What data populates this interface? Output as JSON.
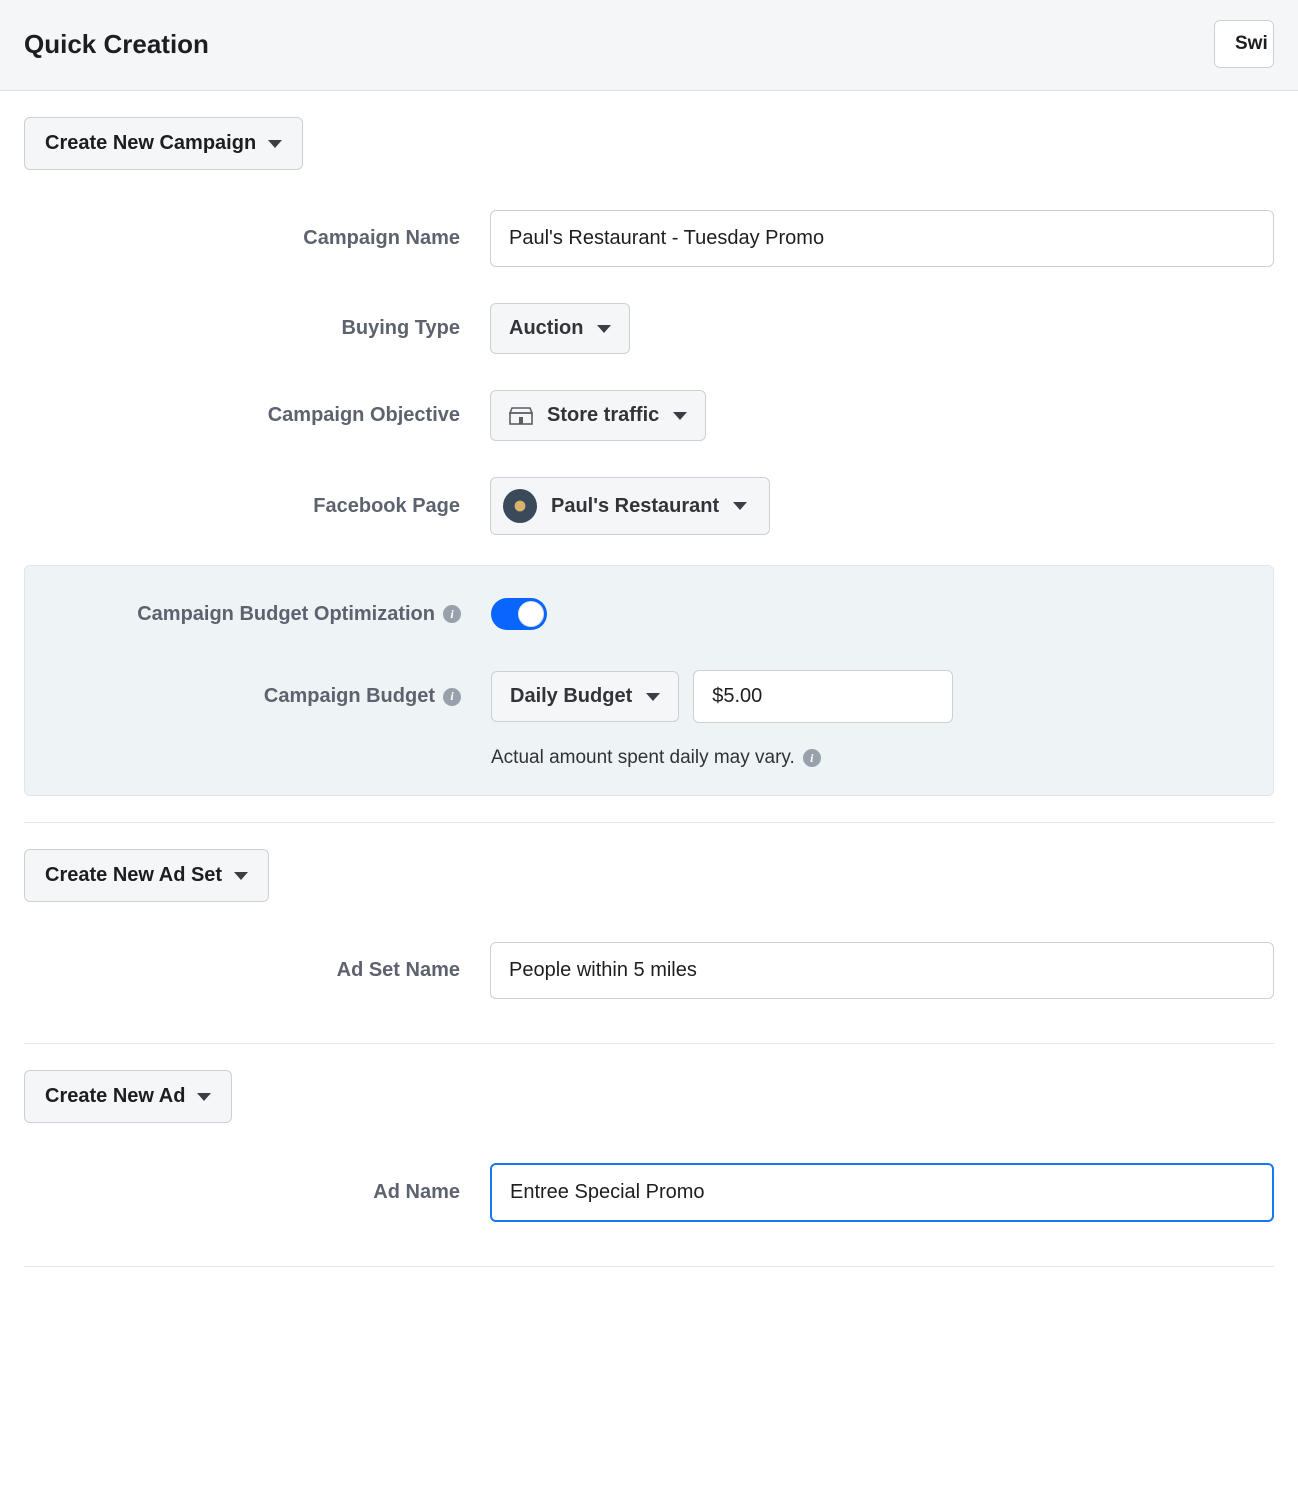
{
  "header": {
    "title": "Quick Creation",
    "switch_label": "Swi"
  },
  "campaign": {
    "button_label": "Create New Campaign",
    "name_label": "Campaign Name",
    "name_value": "Paul's Restaurant - Tuesday Promo",
    "buying_type_label": "Buying Type",
    "buying_type_value": "Auction",
    "objective_label": "Campaign Objective",
    "objective_value": "Store traffic",
    "page_label": "Facebook Page",
    "page_value": "Paul's Restaurant",
    "budget_optimization_label": "Campaign Budget Optimization",
    "budget_optimization_on": true,
    "budget_label": "Campaign Budget",
    "budget_type_value": "Daily Budget",
    "budget_amount_value": "$5.00",
    "budget_note": "Actual amount spent daily may vary."
  },
  "adset": {
    "button_label": "Create New Ad Set",
    "name_label": "Ad Set Name",
    "name_value": "People within 5 miles"
  },
  "ad": {
    "button_label": "Create New Ad",
    "name_label": "Ad Name",
    "name_value": "Entree Special Promo"
  }
}
